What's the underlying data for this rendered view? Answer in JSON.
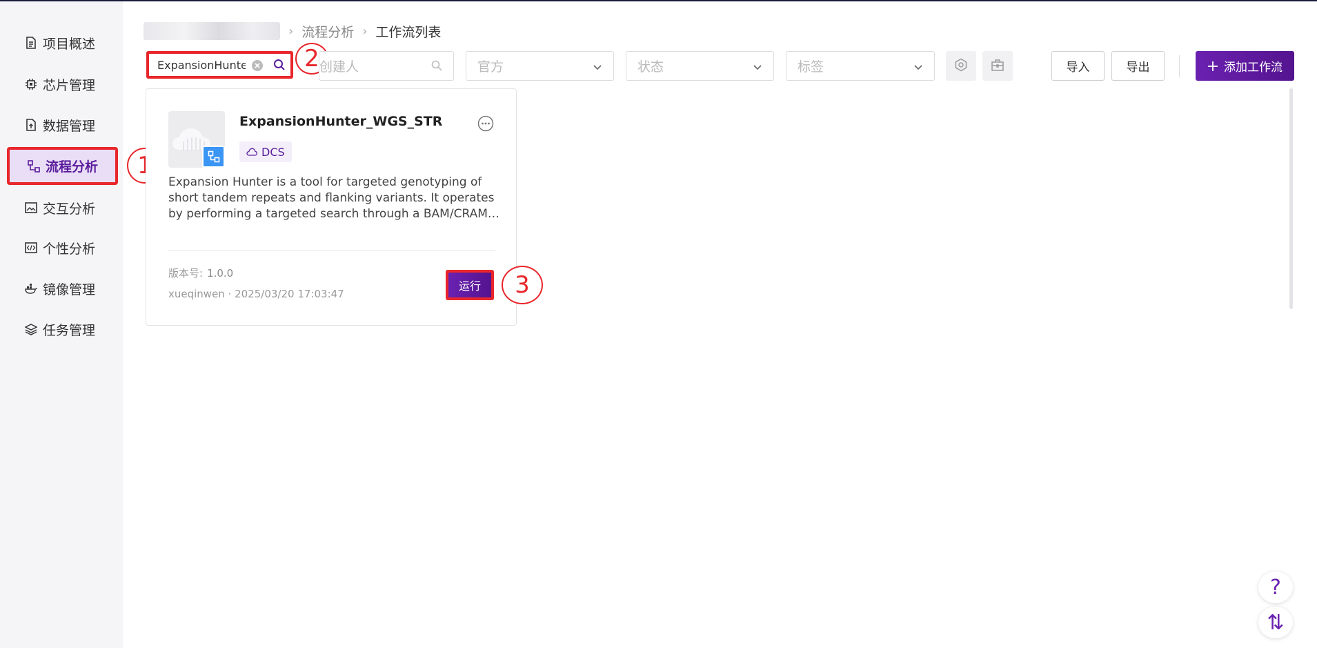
{
  "sidebar": {
    "items": [
      {
        "label": "项目概述",
        "icon": "document-icon"
      },
      {
        "label": "芯片管理",
        "icon": "chip-icon"
      },
      {
        "label": "数据管理",
        "icon": "file-upload-icon"
      },
      {
        "label": "流程分析",
        "icon": "workflow-icon",
        "active": true
      },
      {
        "label": "交互分析",
        "icon": "image-icon"
      },
      {
        "label": "个性分析",
        "icon": "code-icon"
      },
      {
        "label": "镜像管理",
        "icon": "docker-icon"
      },
      {
        "label": "任务管理",
        "icon": "layers-icon"
      }
    ]
  },
  "annotations": {
    "one": "1",
    "two": "2",
    "three": "3"
  },
  "breadcrumb": {
    "mid": "流程分析",
    "last": "工作流列表"
  },
  "toolbar": {
    "search_value": "ExpansionHunter",
    "creator_placeholder": "创建人",
    "official_select": "官方",
    "status_select": "状态",
    "tag_select": "标签",
    "import_label": "导入",
    "export_label": "导出",
    "add_label": "添加工作流"
  },
  "card": {
    "title": "ExpansionHunter_WGS_STR",
    "tag": "DCS",
    "description": "Expansion Hunter is a tool for targeted genotyping of short tandem repeats and flanking variants. It operates by performing a targeted search through a BAM/CRAM file for reads that span, flank, and are fully contained in each repeat.",
    "version_label": "版本号:",
    "version_value": "1.0.0",
    "meta": "xueqinwen · 2025/03/20 17:03:47",
    "run_label": "运行"
  },
  "floating": {
    "help": "?",
    "swap": "⇅"
  },
  "colors": {
    "accent": "#5a1c9c",
    "highlight": "#e8262b",
    "badge": "#3a95f4"
  }
}
